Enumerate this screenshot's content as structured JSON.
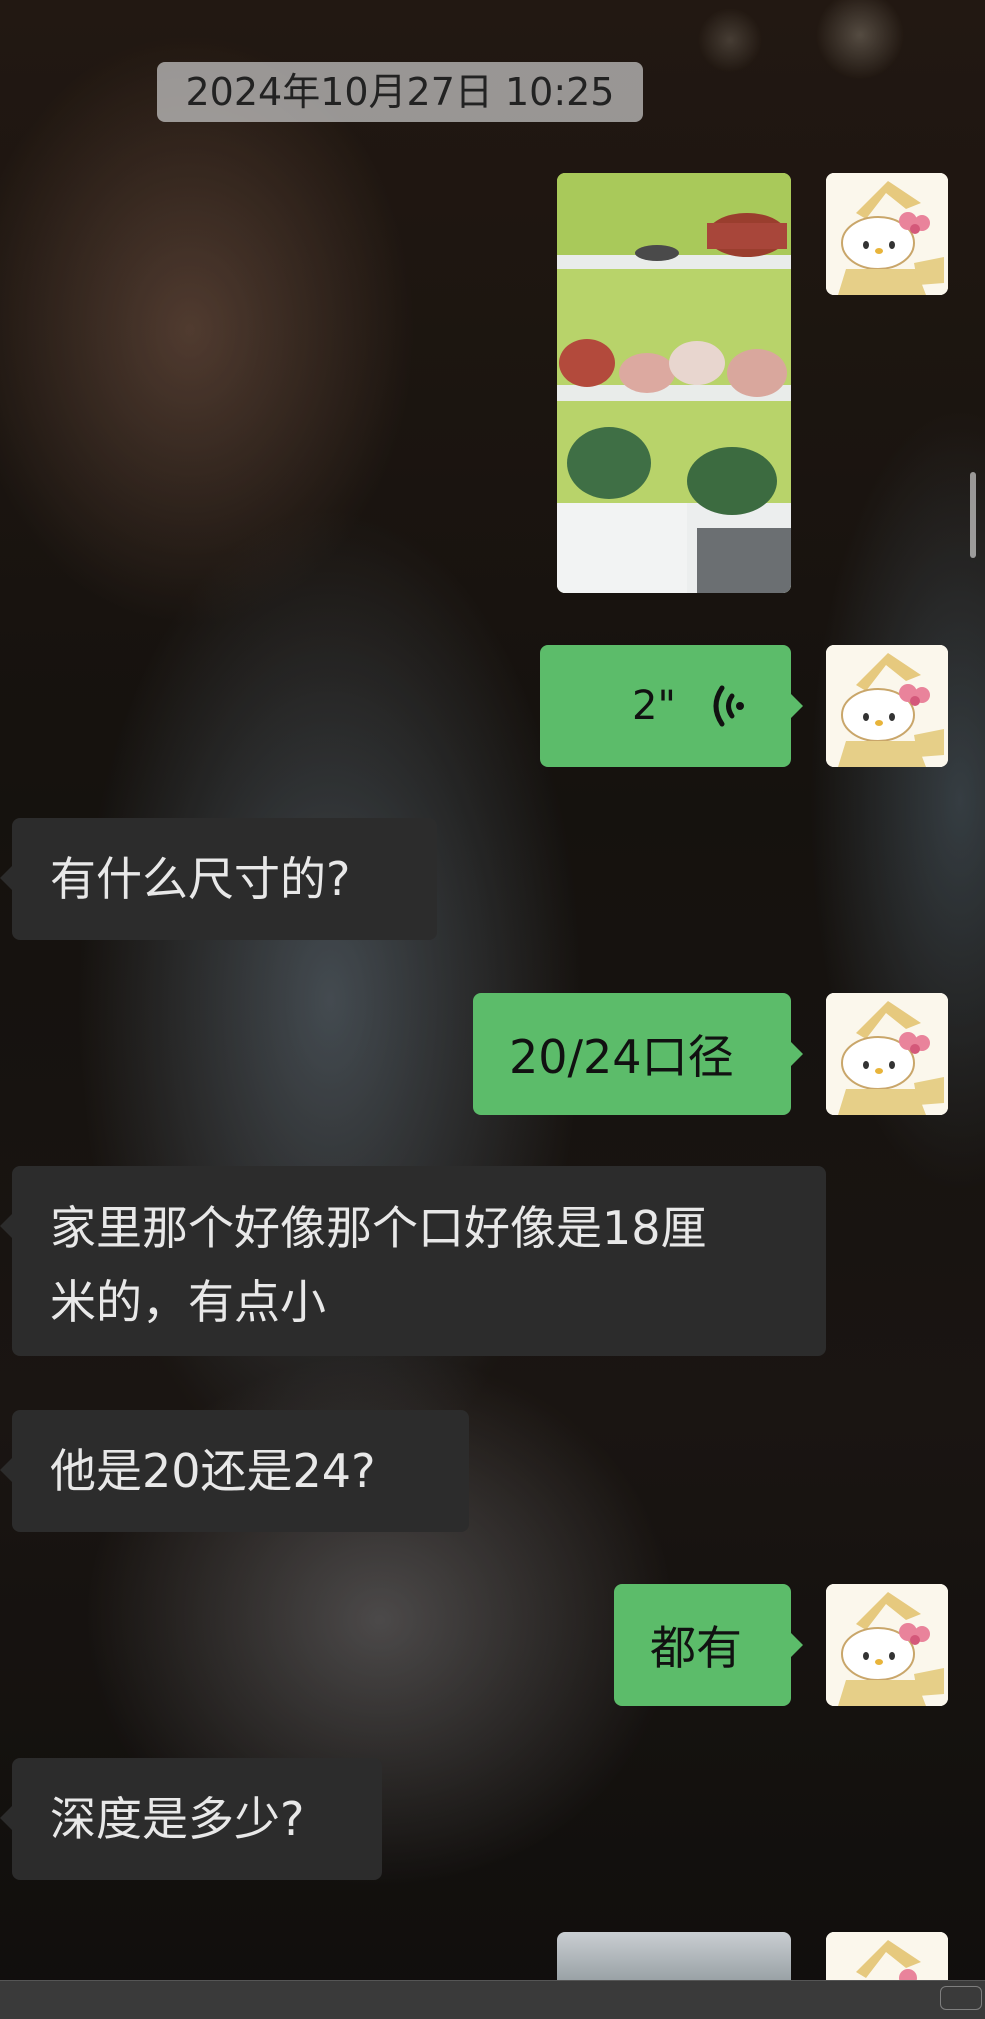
{
  "header": {
    "timestamp": "2024年10月27日 10:25"
  },
  "messages": [
    {
      "side": "out",
      "type": "image",
      "description": "cookware shelf photo"
    },
    {
      "side": "out",
      "type": "voice",
      "duration": "2\""
    },
    {
      "side": "in",
      "type": "text",
      "text": "有什么尺寸的?"
    },
    {
      "side": "out",
      "type": "text",
      "text": "20/24口径"
    },
    {
      "side": "in",
      "type": "text",
      "line1": "家里那个好像那个口好像是18厘",
      "line2": "米的，有点小"
    },
    {
      "side": "in",
      "type": "text",
      "text": "他是20还是24?"
    },
    {
      "side": "out",
      "type": "text",
      "text": "都有"
    },
    {
      "side": "in",
      "type": "text",
      "text": "深度是多少?"
    }
  ],
  "colors": {
    "outgoing_bubble": "#5cbc6a",
    "incoming_bubble": "#2c2c2c",
    "timestamp_bg": "#c8c8c8"
  },
  "icons": {
    "avatar": "hello-kitty-avatar",
    "voice": "voice-wave-icon"
  }
}
